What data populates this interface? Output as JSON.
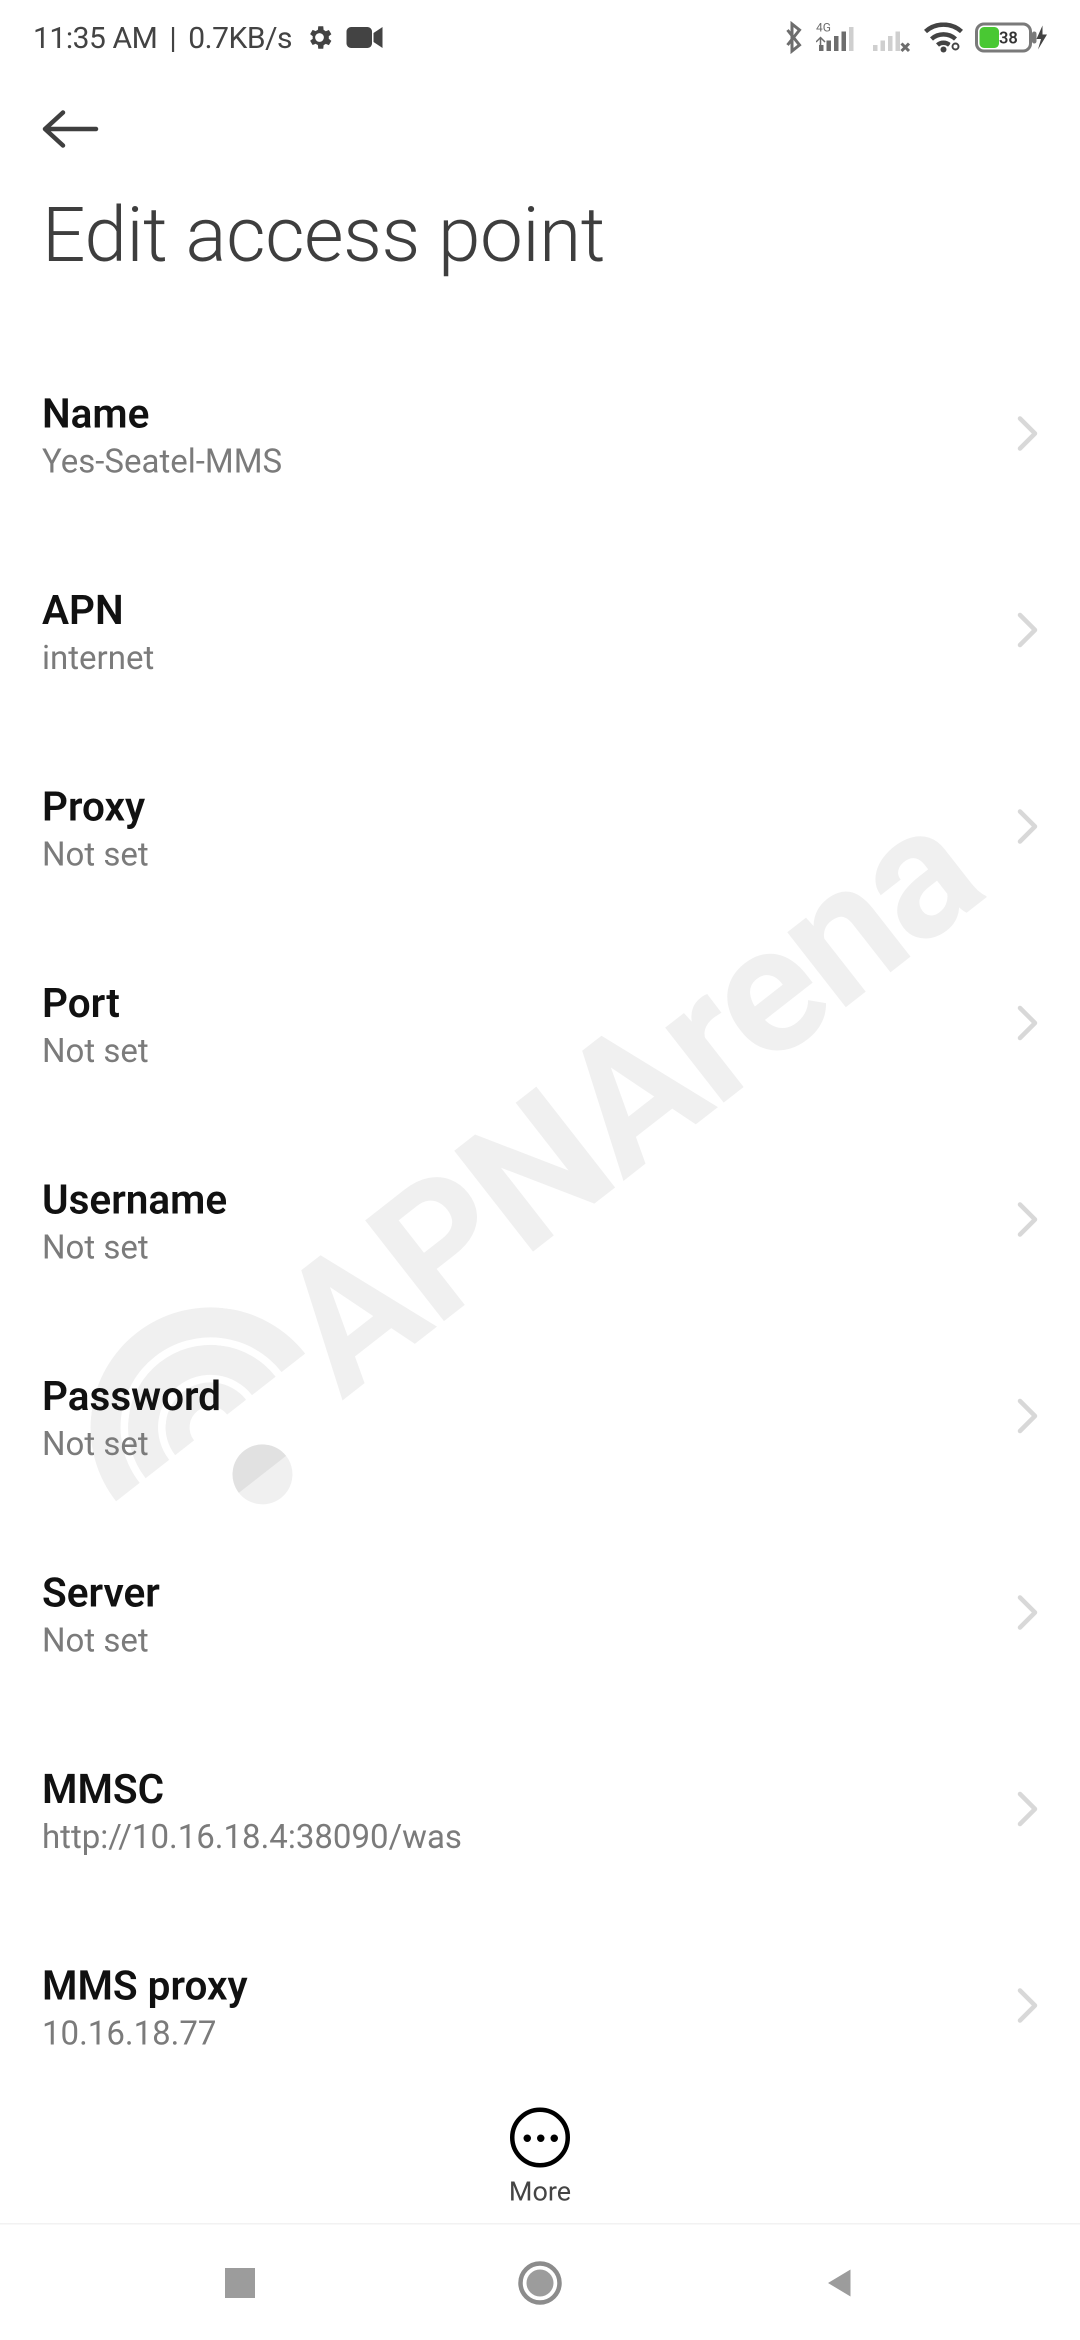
{
  "status": {
    "time": "11:35 AM",
    "net_speed": "0.7KB/s",
    "battery_pct": "38"
  },
  "header": {
    "title": "Edit access point"
  },
  "settings": [
    {
      "label": "Name",
      "value": "Yes-Seatel-MMS"
    },
    {
      "label": "APN",
      "value": "internet"
    },
    {
      "label": "Proxy",
      "value": "Not set"
    },
    {
      "label": "Port",
      "value": "Not set"
    },
    {
      "label": "Username",
      "value": "Not set"
    },
    {
      "label": "Password",
      "value": "Not set"
    },
    {
      "label": "Server",
      "value": "Not set"
    },
    {
      "label": "MMSC",
      "value": "http://10.16.18.4:38090/was"
    },
    {
      "label": "MMS proxy",
      "value": "10.16.18.77"
    }
  ],
  "more_button": {
    "label": "More"
  },
  "watermark_text": "APNArena"
}
